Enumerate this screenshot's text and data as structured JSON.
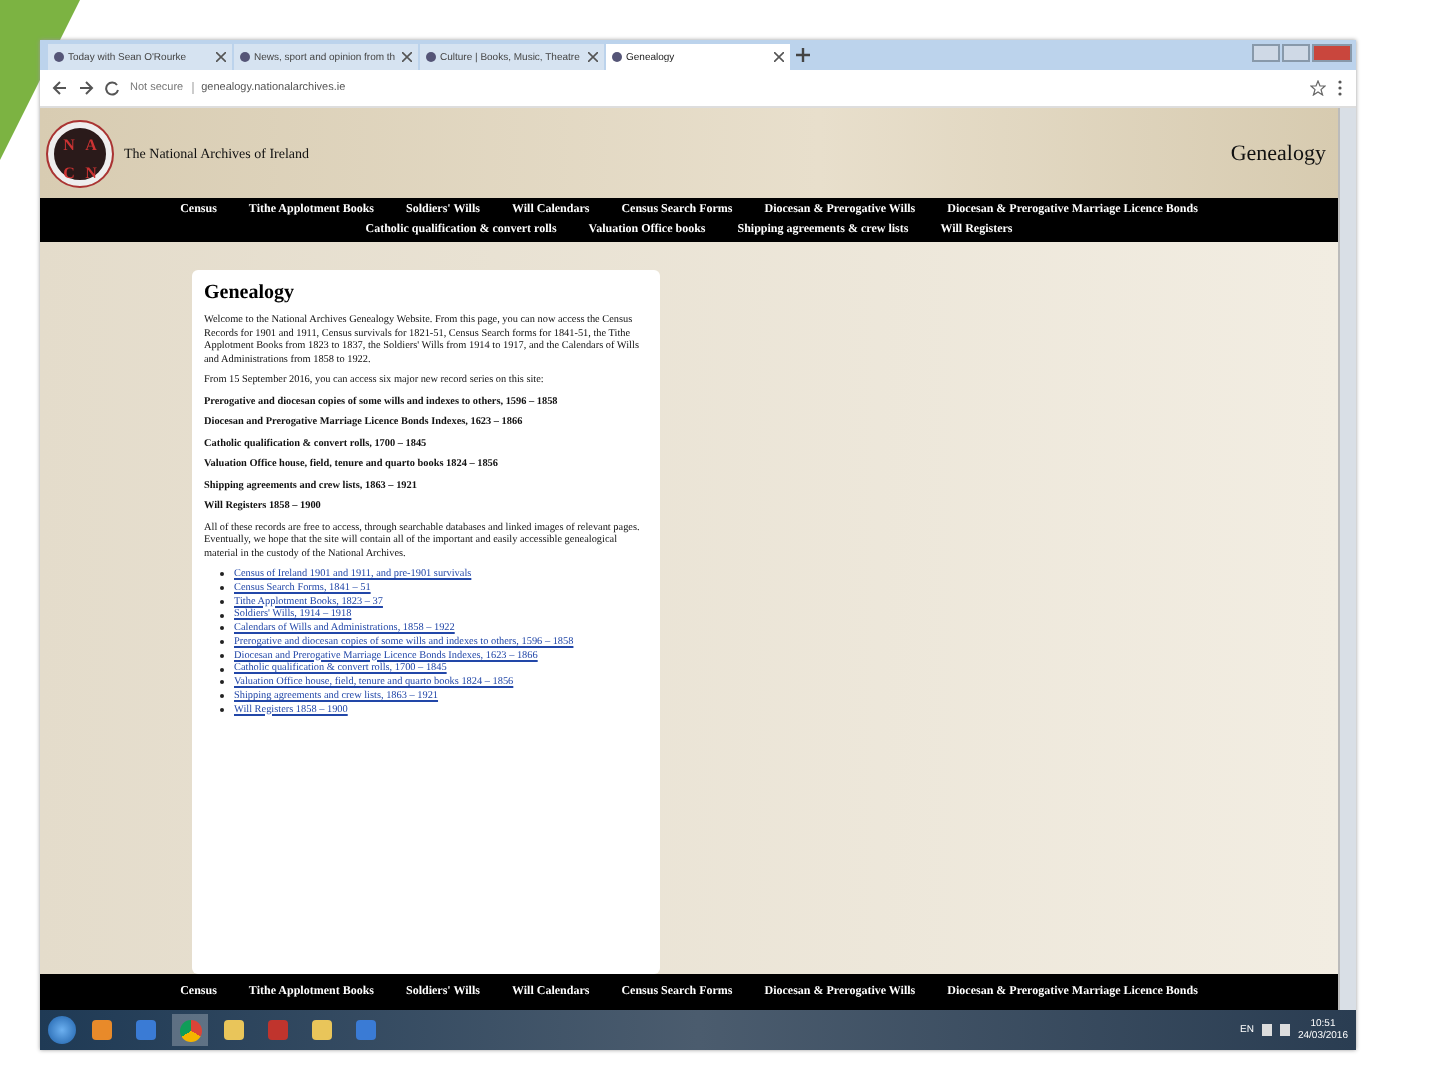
{
  "browser": {
    "tabs": [
      {
        "title": "Today with Sean O'Rourke",
        "selected": false
      },
      {
        "title": "News, sport and opinion from th",
        "selected": false
      },
      {
        "title": "Culture | Books, Music, Theatre",
        "selected": false
      },
      {
        "title": "Genealogy",
        "selected": true
      }
    ],
    "security": "Not secure",
    "url": "genealogy.nationalarchives.ie"
  },
  "header": {
    "logo_letters": [
      "N",
      "A",
      "C",
      "N"
    ],
    "site_name": "The National Archives of Ireland",
    "page_title": "Genealogy"
  },
  "nav_rows": [
    [
      "Census",
      "Tithe Applotment Books",
      "Soldiers' Wills",
      "Will Calendars",
      "Census Search Forms",
      "Diocesan & Prerogative Wills",
      "Diocesan & Prerogative Marriage Licence Bonds"
    ],
    [
      "Catholic qualification & convert rolls",
      "Valuation Office books",
      "Shipping agreements & crew lists",
      "Will Registers"
    ]
  ],
  "content": {
    "heading": "Genealogy",
    "intro": "Welcome to the National Archives Genealogy Website. From this page, you can now access the Census Records for 1901 and 1911, Census survivals for 1821-51, Census Search forms for 1841-51, the Tithe Applotment Books from 1823 to 1837, the Soldiers' Wills from 1914 to 1917, and the Calendars of Wills and Administrations from 1858 to 1922.",
    "new_series_note": "From 15 September 2016, you can access six major new record series on this site:",
    "series": [
      "Prerogative and diocesan copies of some wills and indexes to others, 1596 – 1858",
      "Diocesan and Prerogative Marriage Licence Bonds Indexes, 1623 – 1866",
      "Catholic qualification & convert rolls, 1700 – 1845",
      "Valuation Office house, field, tenure and quarto books 1824 – 1856",
      "Shipping agreements and crew lists, 1863 – 1921",
      "Will Registers 1858 – 1900"
    ],
    "closing": "All of these records are free to access, through searchable databases and linked images of relevant pages. Eventually, we hope that the site will contain all of the important and easily accessible genealogical material in the custody of the National Archives.",
    "links": [
      "Census of Ireland 1901 and 1911, and pre-1901 survivals",
      "Census Search Forms, 1841 – 51",
      "Tithe Applotment Books, 1823 – 37",
      "Soldiers' Wills, 1914 – 1918",
      "Calendars of Wills and Administrations, 1858 – 1922",
      "Prerogative and diocesan copies of some wills and indexes to others, 1596 – 1858",
      "Diocesan and Prerogative Marriage Licence Bonds Indexes, 1623 – 1866",
      "Catholic qualification & convert rolls, 1700 – 1845",
      "Valuation Office house, field, tenure and quarto books 1824 – 1856",
      "Shipping agreements and crew lists, 1863 – 1921",
      "Will Registers 1858 – 1900"
    ]
  },
  "footer_nav": [
    "Census",
    "Tithe Applotment Books",
    "Soldiers' Wills",
    "Will Calendars",
    "Census Search Forms",
    "Diocesan & Prerogative Wills",
    "Diocesan & Prerogative Marriage Licence Bonds"
  ],
  "taskbar": {
    "language": "EN",
    "time": "10:51",
    "date": "24/03/2016"
  }
}
